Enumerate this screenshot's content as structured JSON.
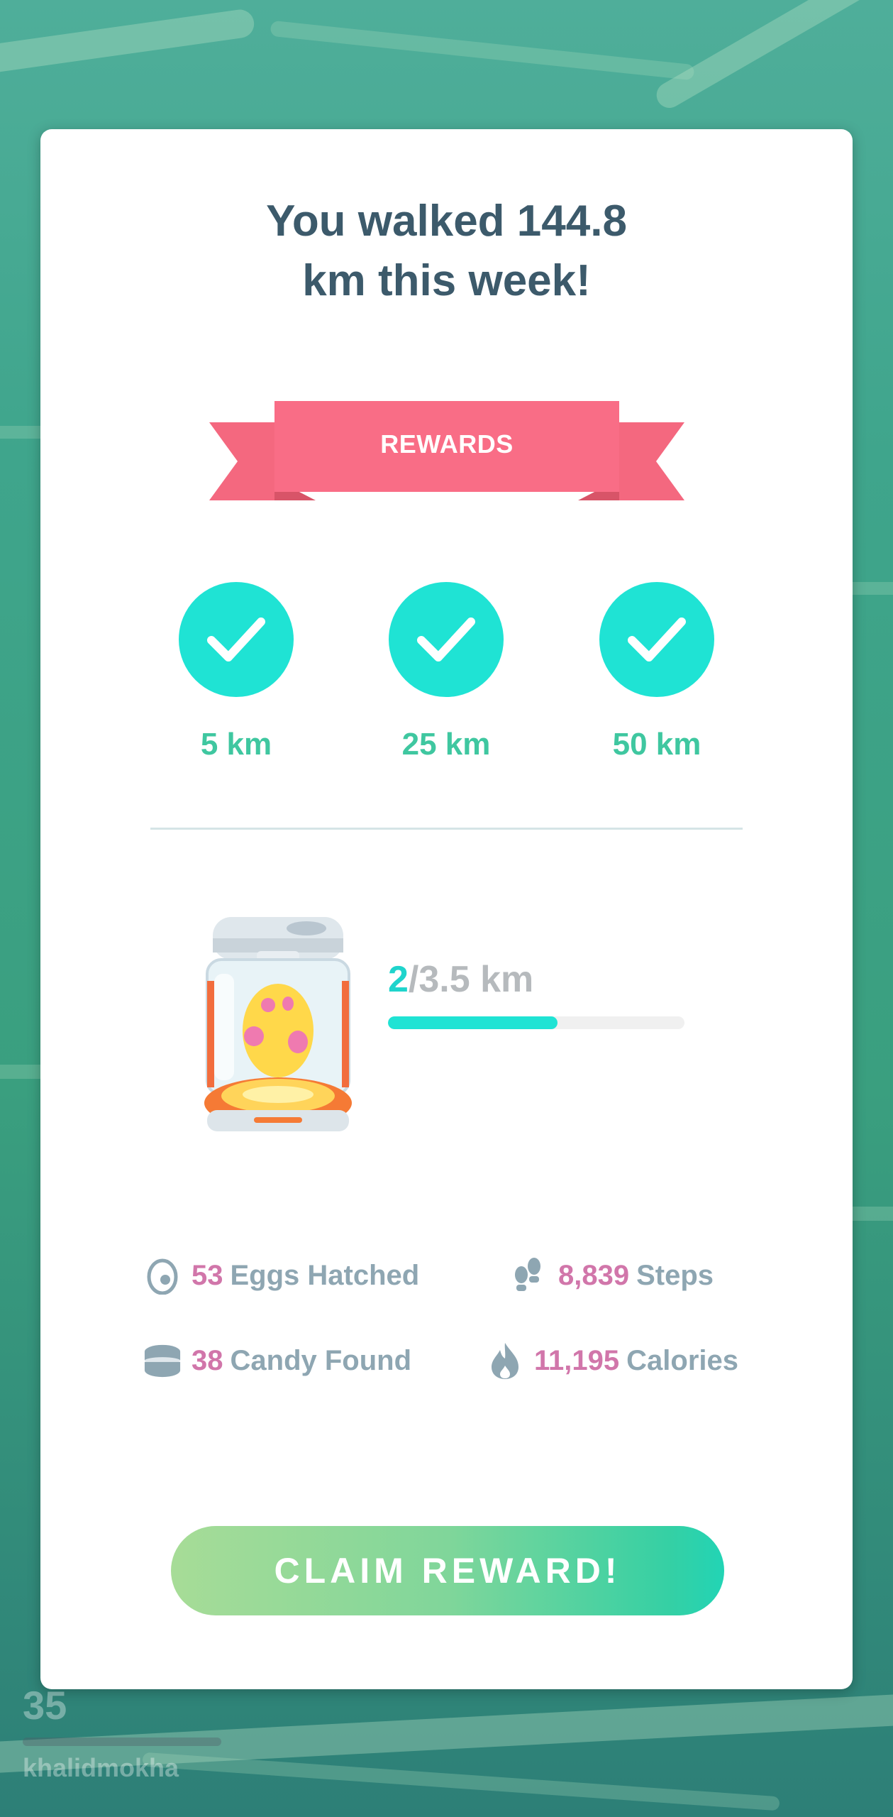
{
  "headline": {
    "line1": "You walked 144.8",
    "line2": "km this week!"
  },
  "ribbon": {
    "label": "REWARDS"
  },
  "milestones": [
    {
      "label": "5 km",
      "completed": true
    },
    {
      "label": "25 km",
      "completed": true
    },
    {
      "label": "50 km",
      "completed": true
    }
  ],
  "egg": {
    "current": "2",
    "total": "/3.5 km",
    "progress_fraction": 0.571
  },
  "stats": {
    "eggs": {
      "num": "53",
      "text": "Eggs Hatched"
    },
    "steps": {
      "num": "8,839",
      "text": "Steps"
    },
    "candy": {
      "num": "38",
      "text": "Candy Found"
    },
    "calories": {
      "num": "11,195",
      "text": "Calories"
    }
  },
  "claim": {
    "label": "CLAIM REWARD!"
  },
  "player": {
    "level": "35",
    "name": "khalidmokha"
  },
  "colors": {
    "teal": "#1fe3d4",
    "milestone_text": "#3fc7a0",
    "ribbon": "#f4687f",
    "stat_number": "#d176aa",
    "stat_text": "#8ea6b2",
    "headline": "#3c5a6b"
  },
  "icons": [
    "check-icon",
    "egg-icon",
    "footsteps-icon",
    "candy-icon",
    "flame-icon",
    "incubator-icon"
  ]
}
